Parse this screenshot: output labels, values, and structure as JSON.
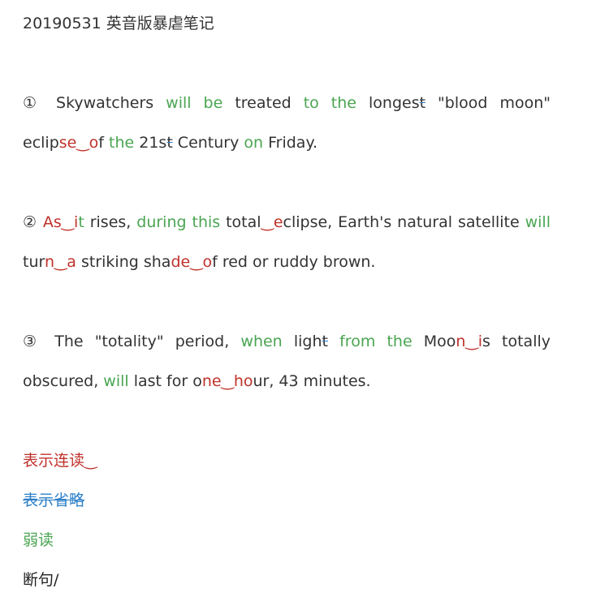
{
  "title": "20190531 英音版暴虐笔记",
  "paragraphs": [
    {
      "segments": [
        {
          "text": "① Skywatchers ",
          "style": "n"
        },
        {
          "text": "will be",
          "style": "g"
        },
        {
          "text": " treated ",
          "style": "n"
        },
        {
          "text": "to the",
          "style": "g"
        },
        {
          "text": " longes",
          "style": "n"
        },
        {
          "text": "t",
          "style": "strike"
        },
        {
          "text": " \"blood moon\" eclip",
          "style": "n"
        },
        {
          "text": "se‿o",
          "style": "r"
        },
        {
          "text": "f",
          "style": "n"
        },
        {
          "text": " the",
          "style": "g"
        },
        {
          "text": " 21s",
          "style": "n"
        },
        {
          "text": "t",
          "style": "strike"
        },
        {
          "text": " Century ",
          "style": "n"
        },
        {
          "text": "on",
          "style": "g"
        },
        {
          "text": " Friday.",
          "style": "n"
        }
      ]
    },
    {
      "segments": [
        {
          "text": "② ",
          "style": "n"
        },
        {
          "text": "As‿i",
          "style": "r"
        },
        {
          "text": "t",
          "style": "g"
        },
        {
          "text": " rises, ",
          "style": "n"
        },
        {
          "text": "during this",
          "style": "g"
        },
        {
          "text": " total",
          "style": "n"
        },
        {
          "text": "‿e",
          "style": "r"
        },
        {
          "text": "clipse, Earth's natural satellite ",
          "style": "n"
        },
        {
          "text": "will",
          "style": "g"
        },
        {
          "text": " tur",
          "style": "n"
        },
        {
          "text": "n‿a",
          "style": "r"
        },
        {
          "text": " striking sha",
          "style": "n"
        },
        {
          "text": "de‿o",
          "style": "r"
        },
        {
          "text": "f red or ruddy brown.",
          "style": "n"
        }
      ]
    },
    {
      "segments": [
        {
          "text": "③ The \"totality\" period, ",
          "style": "n"
        },
        {
          "text": "when",
          "style": "g"
        },
        {
          "text": " ligh",
          "style": "n"
        },
        {
          "text": "t",
          "style": "strike"
        },
        {
          "text": " ",
          "style": "n"
        },
        {
          "text": "from the",
          "style": "g"
        },
        {
          "text": " Moo",
          "style": "n"
        },
        {
          "text": "n‿i",
          "style": "r"
        },
        {
          "text": "s totally obscured, ",
          "style": "n"
        },
        {
          "text": "will",
          "style": "g"
        },
        {
          "text": " last for o",
          "style": "n"
        },
        {
          "text": "ne‿ho",
          "style": "r"
        },
        {
          "text": "ur, 43 minutes.",
          "style": "n"
        }
      ]
    }
  ],
  "legend": {
    "linking": "表示连读‿",
    "omission": "表示省略",
    "weak": "弱读",
    "pause": "断句/"
  },
  "colors": {
    "weak_green": "#4aa552",
    "linking_red": "#c0322b",
    "omission_blue": "#2c7fc9",
    "text": "#333333"
  }
}
